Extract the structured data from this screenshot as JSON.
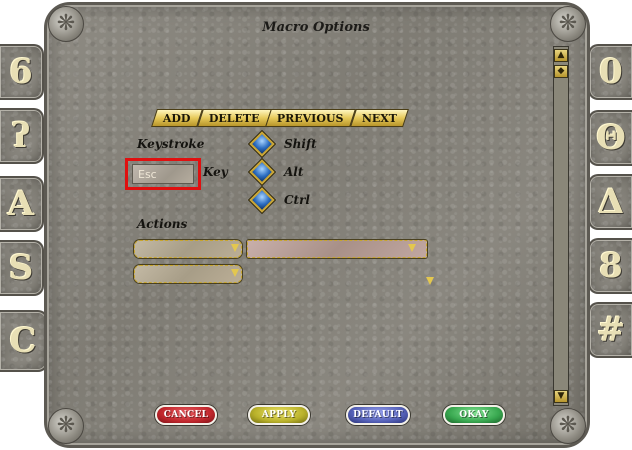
{
  "window": {
    "title": "Macro Options"
  },
  "nav_buttons": [
    {
      "label": "ADD"
    },
    {
      "label": "DELETE"
    },
    {
      "label": "PREVIOUS"
    },
    {
      "label": "NEXT"
    }
  ],
  "keystroke": {
    "label": "Keystroke",
    "key_label": "Key",
    "key_value": "Esc",
    "modifiers": [
      {
        "label": "Shift"
      },
      {
        "label": "Alt"
      },
      {
        "label": "Ctrl"
      }
    ]
  },
  "actions": {
    "label": "Actions"
  },
  "bottom_buttons": [
    {
      "label": "CANCEL",
      "color": "#c1272d"
    },
    {
      "label": "APPLY",
      "color": "#b9b12a"
    },
    {
      "label": "DEFAULT",
      "color": "#5561b8"
    },
    {
      "label": "OKAY",
      "color": "#39a850"
    }
  ],
  "left_tabs": [
    {
      "icon": "rune-6-icon",
      "glyph": "6"
    },
    {
      "icon": "rune-hook-icon",
      "glyph": "ʔ"
    },
    {
      "icon": "rune-a-icon",
      "glyph": "A"
    },
    {
      "icon": "rune-s-icon",
      "glyph": "S"
    },
    {
      "icon": "rune-c-icon",
      "glyph": "C"
    }
  ],
  "right_tabs": [
    {
      "icon": "rune-mouse-icon",
      "glyph": "0"
    },
    {
      "icon": "rune-eye-icon",
      "glyph": "Θ"
    },
    {
      "icon": "rune-triangle-icon",
      "glyph": "Δ"
    },
    {
      "icon": "rune-8-icon",
      "glyph": "8"
    },
    {
      "icon": "rune-grid-icon",
      "glyph": "#"
    }
  ],
  "colors": {
    "highlight": "#e01010",
    "toggle": "#2e6fc2",
    "gold": "#e6c95a"
  }
}
